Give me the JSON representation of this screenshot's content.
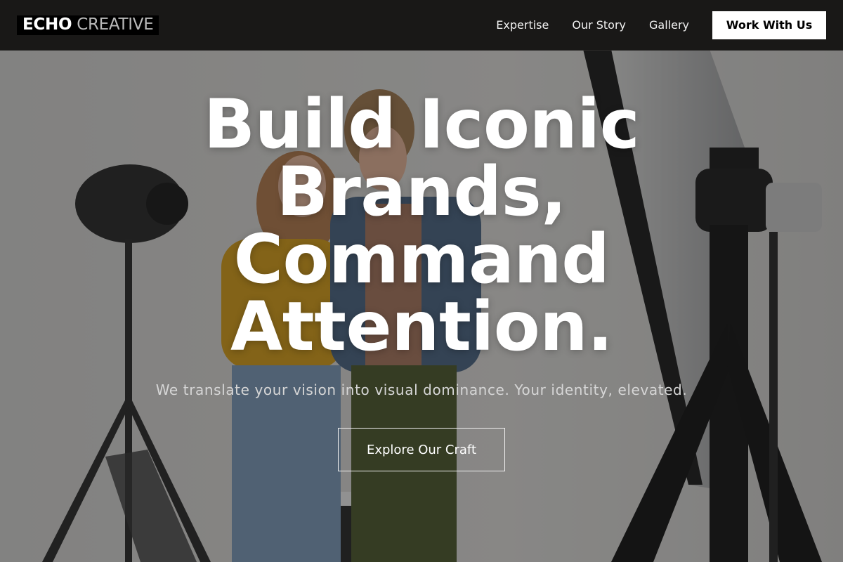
{
  "brand": {
    "name_bold": "ECHO",
    "name_light": "CREATIVE"
  },
  "nav": {
    "links": [
      "Expertise",
      "Our Story",
      "Gallery"
    ],
    "cta_label": "Work With Us"
  },
  "hero": {
    "headline": "Build Iconic Brands, Command Attention.",
    "subheadline": "We translate your vision into visual dominance. Your identity, elevated.",
    "button_label": "Explore Our Craft",
    "image_description": "two people reviewing a camera in a photo studio with lighting equipment"
  },
  "colors": {
    "header_bg": "#191817",
    "logo_bg": "#000000",
    "cta_bg": "#ffffff",
    "headline": "#ffffff",
    "subheadline": "#d6d6d6"
  }
}
